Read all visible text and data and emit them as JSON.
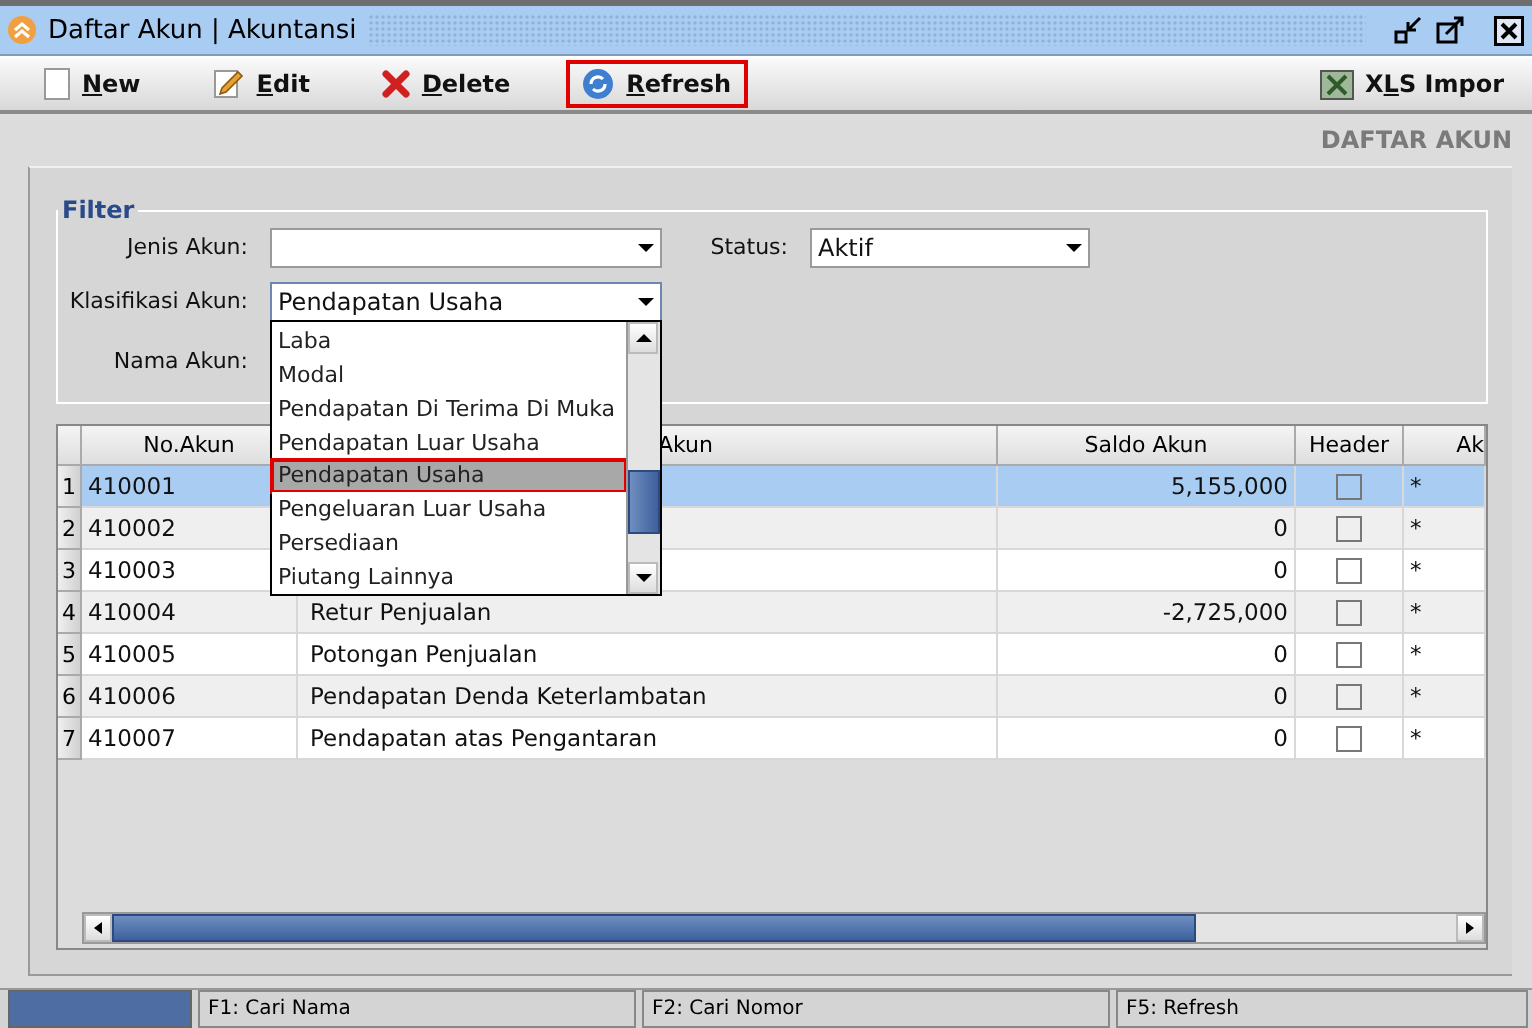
{
  "window": {
    "title": "Daftar Akun | Akuntansi"
  },
  "toolbar": [
    {
      "label": "New",
      "highlighted": false
    },
    {
      "label": "Edit",
      "highlighted": false
    },
    {
      "label": "Delete",
      "highlighted": false
    },
    {
      "label": "Refresh",
      "highlighted": true
    }
  ],
  "toolbar_right": {
    "label": "XLS Impor"
  },
  "heading": "DAFTAR AKUN",
  "filter": {
    "title": "Filter",
    "jenis_akun": {
      "label": "Jenis Akun:"
    },
    "klasifikasi_akun": {
      "label": "Klasifikasi Akun:",
      "value": "Pendapatan Usaha",
      "expanded": true
    },
    "nama_akun": {
      "label": "Nama Akun:"
    },
    "status": {
      "label": "Status:",
      "value": "Aktif"
    }
  },
  "dropdown": [
    {
      "label": "Laba",
      "selected": false
    },
    {
      "label": "Modal",
      "selected": false
    },
    {
      "label": "Pendapatan Di Terima Di Muka",
      "selected": false
    },
    {
      "label": "Pendapatan Luar Usaha",
      "selected": false
    },
    {
      "label": "Pendapatan Usaha",
      "selected": true
    },
    {
      "label": "Pengeluaran Luar Usaha",
      "selected": false
    },
    {
      "label": "Persediaan",
      "selected": false
    },
    {
      "label": "Piutang Lainnya",
      "selected": false
    }
  ],
  "table": {
    "columns": [
      "No.Akun",
      "Akun",
      "Saldo Akun",
      "Header",
      "Ak"
    ],
    "rows": [
      {
        "index": "1",
        "no": "410001",
        "saldo": "5,155,000",
        "header": false,
        "aktif": "*",
        "selected": true
      },
      {
        "index": "2",
        "no": "410002",
        "saldo": "0",
        "header": false,
        "aktif": "*",
        "selected": false
      },
      {
        "index": "3",
        "no": "410003",
        "saldo": "0",
        "header": false,
        "aktif": "*",
        "selected": false
      },
      {
        "index": "4",
        "no": "410004",
        "name": "Retur Penjualan",
        "saldo": "-2,725,000",
        "header": false,
        "aktif": "*",
        "selected": false
      },
      {
        "index": "5",
        "no": "410005",
        "name": "Potongan Penjualan",
        "saldo": "0",
        "header": false,
        "aktif": "*",
        "selected": false
      },
      {
        "index": "6",
        "no": "410006",
        "name": "Pendapatan Denda Keterlambatan",
        "saldo": "0",
        "header": false,
        "aktif": "*",
        "selected": false
      },
      {
        "index": "7",
        "no": "410007",
        "name": "Pendapatan atas Pengantaran",
        "saldo": "0",
        "header": false,
        "aktif": "*",
        "selected": false
      }
    ]
  },
  "status_bar": [
    "F1: Cari Nama",
    "F2: Cari Nomor",
    "F5: Refresh"
  ]
}
